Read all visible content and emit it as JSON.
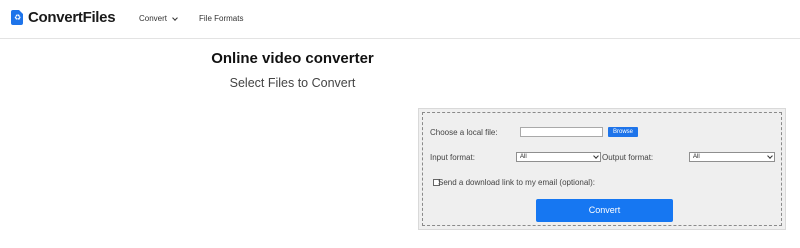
{
  "header": {
    "brand": "ConvertFiles",
    "nav": {
      "convert_label": "Convert",
      "file_formats_label": "File Formats"
    }
  },
  "main": {
    "title": "Online video converter",
    "subtitle": "Select Files to Convert"
  },
  "form": {
    "choose_file_label": "Choose a local file:",
    "browse_label": "Browse",
    "input_format_label": "Input format:",
    "input_format_value": "All",
    "output_format_label": "Output format:",
    "output_format_value": "All",
    "email_option_label": "Send a download link to my email (optional):",
    "convert_label": "Convert"
  },
  "colors": {
    "accent": "#1e74ea"
  }
}
